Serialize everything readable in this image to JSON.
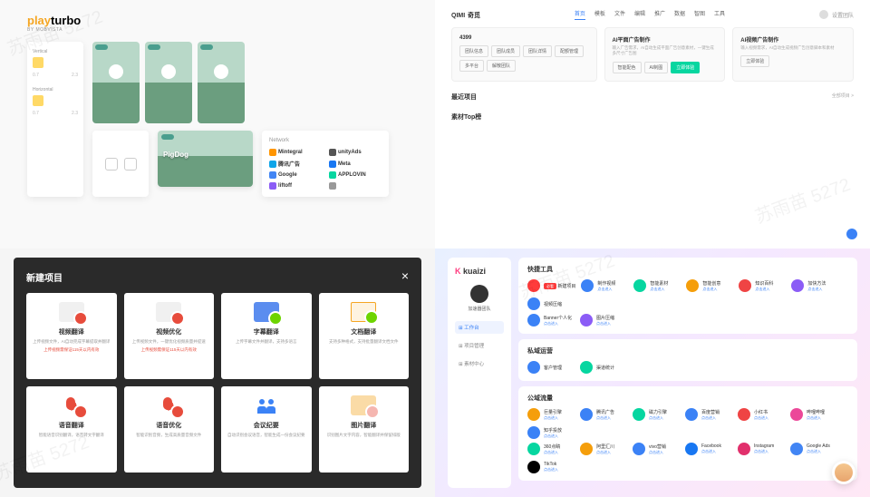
{
  "watermark": "苏雨苗 5272",
  "p1": {
    "logo_play": "play",
    "logo_turbo": "turbo",
    "logo_sub": "BY MOBVISTA",
    "controls": {
      "vertical": "Vertical",
      "horizontal": "Horizontal",
      "min": "0.7",
      "max": "2.3"
    },
    "preview_title": "PigDog",
    "network_title": "Network",
    "networks": [
      "Mintegral",
      "unityAds",
      "腾讯广告",
      "Meta",
      "Google",
      "APPLOVIN",
      "liftoff",
      ""
    ]
  },
  "p2": {
    "logo": "QIMI",
    "logo_sub": "奇觅",
    "nav": [
      "首页",
      "模板",
      "文件",
      "编辑",
      "推广",
      "数据",
      "智图",
      "工具"
    ],
    "user": "设置团队",
    "cards": [
      {
        "title": "4399",
        "desc": "",
        "tags": [
          "团队信息",
          "团队成员",
          "团队详情",
          "配额管理",
          "多平台",
          "解散团队"
        ]
      },
      {
        "title": "AI平面广告制作",
        "desc": "输入广告需求，AI自动生成平面广告创意素材，一键生成多尺寸广告图",
        "tags": [
          "智能配色",
          "AI制图",
          "立即体验"
        ],
        "primary": 2
      },
      {
        "title": "AI视频广告制作",
        "desc": "输入视频需求，AI自动生成视频广告创意脚本和素材",
        "tags": [
          "立即体验"
        ]
      }
    ],
    "sections": [
      {
        "title": "最近项目",
        "more": "全部项目 >"
      },
      {
        "title": "素材Top榜"
      }
    ]
  },
  "p3": {
    "title": "新建项目",
    "cells": [
      {
        "title": "视频翻译",
        "desc": "上传视频文件，AI自动完成字幕提取并翻译",
        "note": "上传视频需保证115天以内有效"
      },
      {
        "title": "视频优化",
        "desc": "上传视频文件，一键优化视频质量并提速",
        "note": "上传视频需保证115天以内有效"
      },
      {
        "title": "字幕翻译",
        "desc": "上传字幕文件并翻译，支持多语言",
        "note": ""
      },
      {
        "title": "文档翻译",
        "desc": "支持多种格式，支持批量翻译文档文件",
        "note": ""
      },
      {
        "title": "语音翻译",
        "desc": "智能语音识别翻译，语音转文字翻译",
        "note": ""
      },
      {
        "title": "语音优化",
        "desc": "智能识别音频，生成高质量音频文件",
        "note": ""
      },
      {
        "title": "会议纪要",
        "desc": "自动识别会议语音，智能生成一份会议纪要",
        "note": ""
      },
      {
        "title": "图片翻译",
        "desc": "识别图片文字内容，智能翻译并保留排版",
        "note": ""
      }
    ]
  },
  "p4": {
    "logo1": "K",
    "logo2": "kuaizi",
    "username": "加速器团队",
    "menu": [
      "工作台",
      "项目管理",
      "素材中心"
    ],
    "sec1_title": "快捷工具",
    "sec1_row1": [
      {
        "label": "新建项目",
        "sub": "",
        "color": "#ff3b3b",
        "badge": "必看"
      },
      {
        "label": "制作视频",
        "sub": "点击进入",
        "color": "#3b82f6"
      },
      {
        "label": "智能素材",
        "sub": "点击进入",
        "color": "#06d6a0"
      },
      {
        "label": "智能创意",
        "sub": "点击进入",
        "color": "#f59e0b"
      },
      {
        "label": "知识百科",
        "sub": "点击进入",
        "color": "#ef4444"
      },
      {
        "label": "加快方法",
        "sub": "点击进入",
        "color": "#8b5cf6"
      },
      {
        "label": "视频压缩",
        "sub": "",
        "color": "#3b82f6"
      }
    ],
    "sec1_row2": [
      {
        "label": "Banner个人化",
        "sub": "点击进入",
        "color": "#3b82f6"
      },
      {
        "label": "图片压缩",
        "sub": "点击进入",
        "color": "#8b5cf6"
      }
    ],
    "sec2_title": "私域运营",
    "sec2_items": [
      {
        "label": "客户管理",
        "sub": "",
        "color": "#3b82f6"
      },
      {
        "label": "渠道统计",
        "sub": "",
        "color": "#06d6a0"
      }
    ],
    "sec3_title": "公域流量",
    "sec3_row1": [
      {
        "label": "巨量引擎",
        "sub": "点击进入",
        "color": "#f59e0b"
      },
      {
        "label": "腾讯广告",
        "sub": "点击进入",
        "color": "#3b82f6"
      },
      {
        "label": "磁力引擎",
        "sub": "点击进入",
        "color": "#06d6a0"
      },
      {
        "label": "百度营销",
        "sub": "点击进入",
        "color": "#3b82f6"
      },
      {
        "label": "小红书",
        "sub": "点击进入",
        "color": "#ef4444"
      },
      {
        "label": "哔哩哔哩",
        "sub": "点击进入",
        "color": "#ec4899"
      },
      {
        "label": "知乎投放",
        "sub": "点击进入",
        "color": "#3b82f6"
      }
    ],
    "sec3_row2": [
      {
        "label": "360点睛",
        "sub": "点击进入",
        "color": "#06d6a0"
      },
      {
        "label": "阿里汇川",
        "sub": "点击进入",
        "color": "#f59e0b"
      },
      {
        "label": "vivo营销",
        "sub": "点击进入",
        "color": "#3b82f6"
      },
      {
        "label": "Facebook",
        "sub": "点击进入",
        "color": "#1877f2"
      },
      {
        "label": "Instagram",
        "sub": "点击进入",
        "color": "#e1306c"
      },
      {
        "label": "Google Ads",
        "sub": "点击进入",
        "color": "#4285f4"
      },
      {
        "label": "TikTok",
        "sub": "点击进入",
        "color": "#000"
      }
    ]
  }
}
